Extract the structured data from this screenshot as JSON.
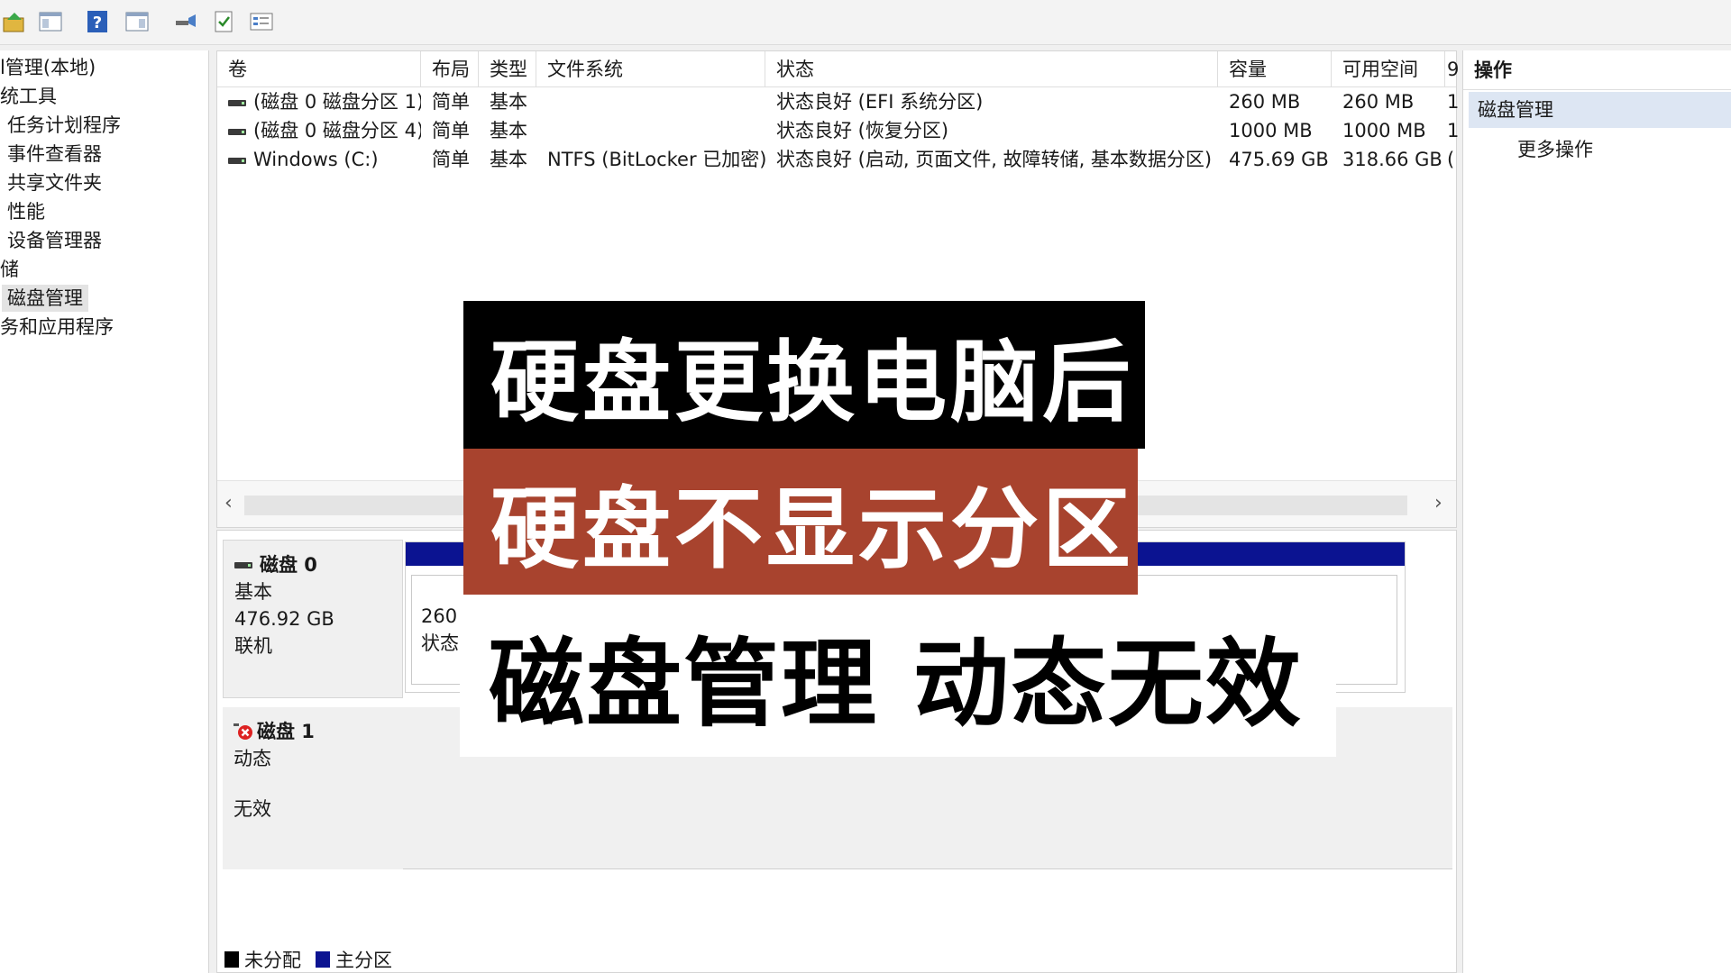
{
  "toolbar": {
    "buttons": [
      {
        "name": "up-folder-icon"
      },
      {
        "name": "show-hide-tree-icon"
      },
      {
        "name": "help-icon"
      },
      {
        "name": "action-pane-icon"
      },
      {
        "name": "connect-icon"
      },
      {
        "name": "checklist-icon"
      },
      {
        "name": "properties-icon"
      }
    ]
  },
  "tree": {
    "items": [
      {
        "label": "l管理(本地)"
      },
      {
        "label": "统工具"
      },
      {
        "label": "任务计划程序"
      },
      {
        "label": "事件查看器"
      },
      {
        "label": "共享文件夹"
      },
      {
        "label": "性能"
      },
      {
        "label": "设备管理器"
      },
      {
        "label": "储"
      },
      {
        "label": "磁盘管理"
      },
      {
        "label": "务和应用程序"
      }
    ]
  },
  "table": {
    "headers": [
      "卷",
      "布局",
      "类型",
      "文件系统",
      "状态",
      "容量",
      "可用空间",
      "9"
    ],
    "rows": [
      {
        "volume": "(磁盘 0 磁盘分区 1)",
        "layout": "简单",
        "type": "基本",
        "fs": "",
        "status": "状态良好 (EFI 系统分区)",
        "capacity": "260 MB",
        "free": "260 MB",
        "extra": "1"
      },
      {
        "volume": "(磁盘 0 磁盘分区 4)",
        "layout": "简单",
        "type": "基本",
        "fs": "",
        "status": "状态良好 (恢复分区)",
        "capacity": "1000 MB",
        "free": "1000 MB",
        "extra": "1"
      },
      {
        "volume": "Windows (C:)",
        "layout": "简单",
        "type": "基本",
        "fs": "NTFS (BitLocker 已加密)",
        "status": "状态良好 (启动, 页面文件, 故障转储, 基本数据分区)",
        "capacity": "475.69 GB",
        "free": "318.66 GB",
        "extra": "("
      }
    ],
    "scroll_left": "‹",
    "scroll_right": "›"
  },
  "disks": {
    "disk0": {
      "title": "磁盘 0",
      "type": "基本",
      "size": "476.92 GB",
      "state": "联机",
      "part_size": "260 I",
      "part_state": "状态|"
    },
    "disk1": {
      "title": "磁盘 1",
      "type": "动态",
      "state": "无效"
    }
  },
  "legend": {
    "unallocated": "未分配",
    "primary": "主分区",
    "unallocated_color": "#000000",
    "primary_color": "#0b1391"
  },
  "actions": {
    "header": "操作",
    "selected": "磁盘管理",
    "more": "更多操作"
  },
  "overlay": {
    "line1": "硬盘更换电脑后",
    "line2": "硬盘不显示分区",
    "line3": "磁盘管理 动态无效"
  }
}
